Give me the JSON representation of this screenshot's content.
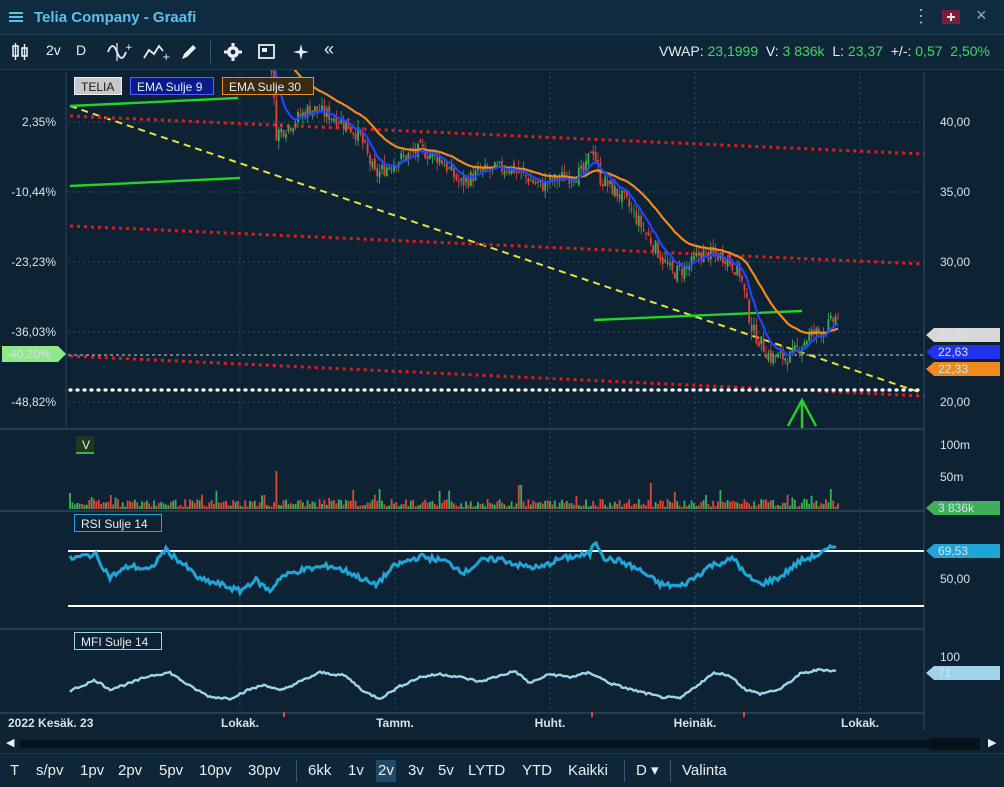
{
  "window": {
    "title": "Telia Company - Graafi"
  },
  "toolbar": {
    "period": "2v",
    "interval": "D",
    "stats": {
      "vwap_label": "VWAP:",
      "vwap_value": "23,1999",
      "v_label": "V:",
      "v_value": "3 836k",
      "l_label": "L:",
      "l_value": "23,37",
      "pm_label": "+/-:",
      "pm_value": "0,57",
      "pct_value": "2,50%"
    }
  },
  "legend": {
    "symbol": "TELIA",
    "ema9": "EMA Sulje 9",
    "ema30": "EMA Sulje 30",
    "volume": "V",
    "rsi": "RSI Sulje 14",
    "mfi": "MFI Sulje 14"
  },
  "price_axis": {
    "ticks": [
      "40,00",
      "35,00",
      "30,00",
      "20,00"
    ]
  },
  "pct_axis": {
    "ticks": [
      "2,35%",
      "-10,44%",
      "-23,23%",
      "-36,03%",
      "-48,82%"
    ],
    "marker": "-40,20%"
  },
  "price_tags": {
    "last": "23,37",
    "ema9": "22,63",
    "ema30": "22,33"
  },
  "volume_axis": {
    "ticks": [
      "100m",
      "50m"
    ],
    "tag": "3 836k"
  },
  "rsi_axis": {
    "ticks": [
      "50,00"
    ],
    "tag": "69,53"
  },
  "mfi_axis": {
    "ticks": [
      "100"
    ],
    "tag": "71"
  },
  "time_axis": {
    "labels": [
      "2022 Kesäk. 23",
      "Lokak.",
      "Tamm.",
      "Huht.",
      "Heinäk.",
      "Lokak."
    ]
  },
  "ranges": {
    "items": [
      "T",
      "s/pv",
      "1pv",
      "2pv",
      "5pv",
      "10pv",
      "30pv",
      "6kk",
      "1v",
      "2v",
      "3v",
      "5v",
      "LYTD",
      "YTD",
      "Kaikki",
      "D",
      "Valinta"
    ],
    "active": "2v"
  },
  "colors": {
    "up": "#3fae5a",
    "down": "#e0463c",
    "ema9": "#2244ff",
    "ema30": "#f08a1c",
    "rsi": "#1fa6d8",
    "mfi": "#9fd3ea",
    "trend": "#e8e23c",
    "channel": "#e01c1c",
    "green_line": "#27d02a"
  }
}
